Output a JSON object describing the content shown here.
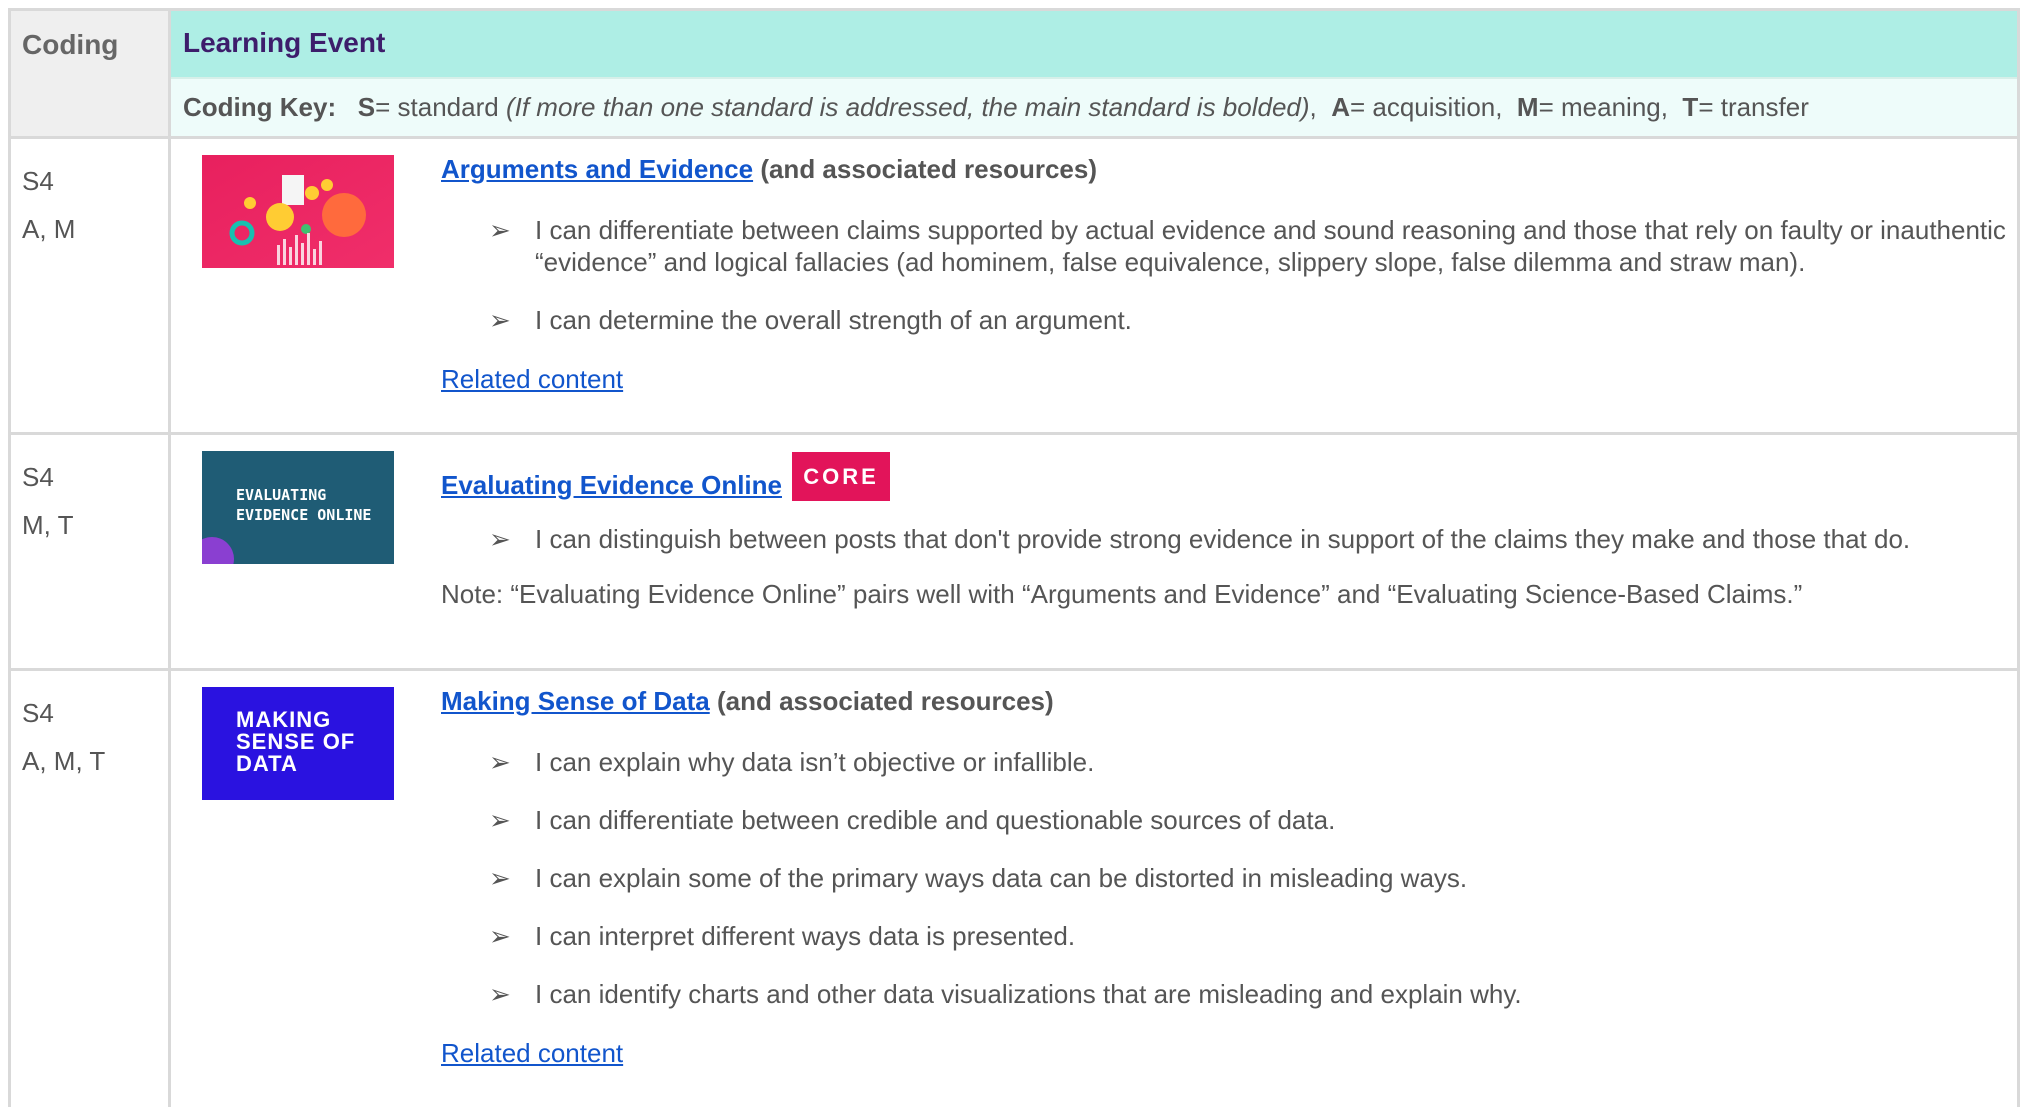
{
  "header": {
    "coding_label": "Coding",
    "learning_event_label": "Learning Event",
    "key": {
      "prefix": "Coding Key:",
      "s_key": "S",
      "s_text": "= standard",
      "s_note": "(If more than one standard is addressed, the main standard is bolded)",
      "a_key": "A",
      "a_text": "= acquisition,",
      "m_key": "M",
      "m_text": "= meaning,",
      "t_key": "T",
      "t_text": "= transfer"
    }
  },
  "rows": [
    {
      "standard": "S4",
      "codes": "A, M",
      "title": "Arguments and Evidence",
      "suffix": "(and associated resources)",
      "bullets": [
        "I can differentiate between claims supported by actual evidence and sound reasoning and those that rely on faulty or inauthentic “evidence” and logical fallacies (ad hominem, false equivalence, slippery slope, false dilemma and straw man).",
        "I can determine the overall strength of an argument."
      ],
      "related": "Related content"
    },
    {
      "standard": "S4",
      "codes": "M, T",
      "title": "Evaluating Evidence Online",
      "badge": "CORE",
      "thumb_text": "EVALUATING EVIDENCE ONLINE",
      "bullets": [
        "I can distinguish between posts that don't provide strong evidence in support of the claims they make and those that do."
      ],
      "note": "Note: “Evaluating Evidence Online” pairs well with “Arguments and Evidence” and “Evaluating Science-Based Claims.”"
    },
    {
      "standard": "S4",
      "codes": "A, M, T",
      "title": "Making Sense of Data",
      "suffix": "(and associated resources)",
      "thumb_text": "MAKING SENSE OF DATA",
      "bullets": [
        "I can explain why data isn’t objective or infallible.",
        "I can differentiate between credible and questionable sources of data.",
        "I can explain some of the primary ways data can be distorted in misleading ways.",
        "I can interpret different ways data is presented.",
        "I can identify charts and other data visualizations that are misleading and explain why."
      ],
      "related": "Related content"
    }
  ],
  "colors": {
    "header_accent": "#aeeee5",
    "header_title": "#3d1d6b",
    "link": "#1155cc",
    "core_badge": "#e2145a"
  }
}
